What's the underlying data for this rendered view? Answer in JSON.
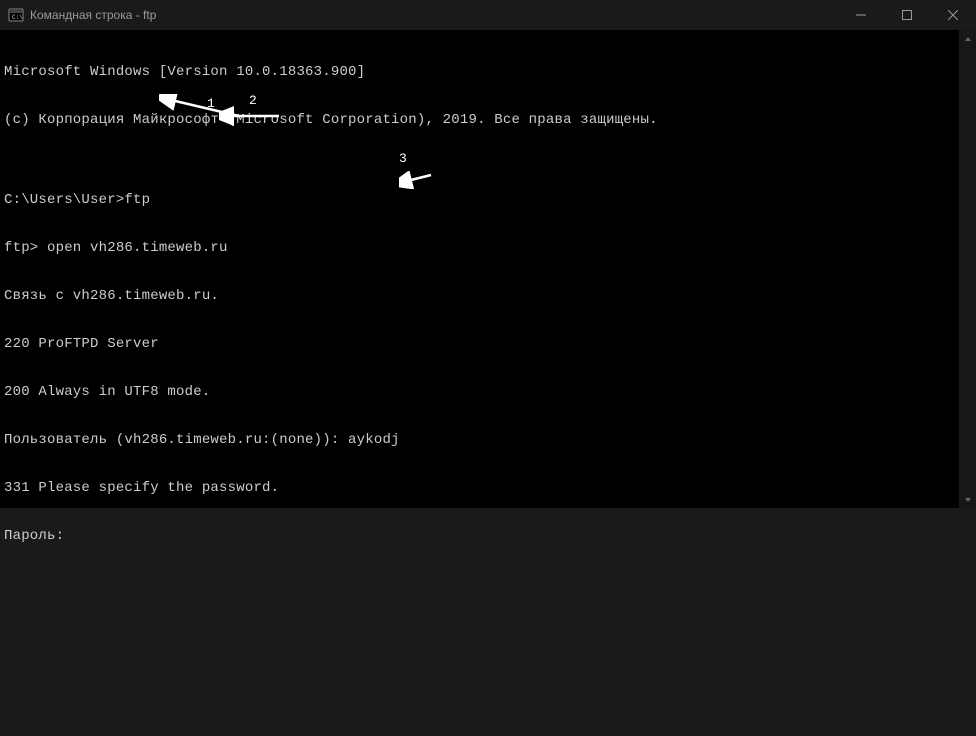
{
  "titlebar": {
    "title": "Командная строка - ftp"
  },
  "terminal": {
    "lines": {
      "l0": "Microsoft Windows [Version 10.0.18363.900]",
      "l1": "(c) Корпорация Майкрософт (Microsoft Corporation), 2019. Все права защищены.",
      "l2": "",
      "l3": "C:\\Users\\User>ftp",
      "l4": "ftp> open vh286.timeweb.ru",
      "l5": "Связь с vh286.timeweb.ru.",
      "l6": "220 ProFTPD Server",
      "l7": "200 Always in UTF8 mode.",
      "l8": "Пользователь (vh286.timeweb.ru:(none)): aykodj",
      "l9": "331 Please specify the password.",
      "l10": "Пароль:"
    }
  },
  "annotations": {
    "a1": "1",
    "a2": "2",
    "a3": "3"
  }
}
